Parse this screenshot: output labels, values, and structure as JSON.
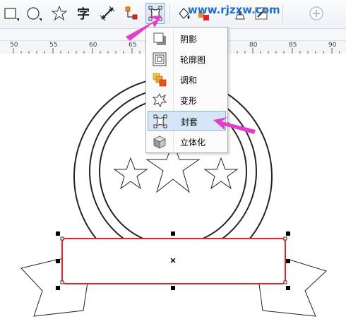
{
  "watermark": "www.rjzxw.com",
  "toolbar": {
    "tools": [
      {
        "name": "rectangle-tool-icon"
      },
      {
        "name": "ellipse-tool-icon"
      },
      {
        "name": "star-tool-icon"
      },
      {
        "name": "text-tool-icon",
        "glyph": "字"
      },
      {
        "name": "dimension-tool-icon"
      },
      {
        "name": "connector-tool-icon"
      },
      {
        "name": "interactive-envelope-tool-icon"
      },
      {
        "name": "fill-tool-icon"
      },
      {
        "name": "color-tool-icon"
      },
      {
        "name": "outline-tool-icon"
      },
      {
        "name": "eyedropper-tool-icon"
      },
      {
        "name": "add-icon"
      }
    ]
  },
  "ruler": {
    "labels": [
      "50",
      "55",
      "60",
      "65",
      "80",
      "85",
      "90"
    ]
  },
  "menu": {
    "items": [
      {
        "label": "阴影",
        "icon": "shadow-icon"
      },
      {
        "label": "轮廓图",
        "icon": "contour-icon"
      },
      {
        "label": "调和",
        "icon": "blend-icon"
      },
      {
        "label": "变形",
        "icon": "distort-icon"
      },
      {
        "label": "封套",
        "icon": "envelope-icon",
        "highlighted": true
      },
      {
        "label": "立体化",
        "icon": "extrude-icon"
      }
    ]
  },
  "colors": {
    "accent_arrow": "#e040c8",
    "selection_outline": "#e8202a",
    "menu_highlight": "#d5e6f7",
    "watermark": "#1a6fd6"
  }
}
